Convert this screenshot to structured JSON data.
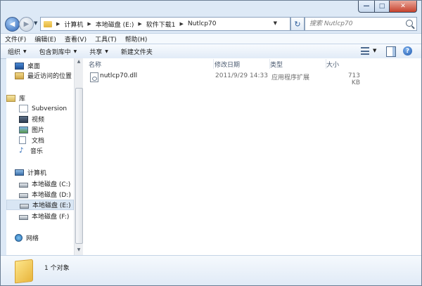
{
  "window": {
    "controls": {
      "minimize": "—",
      "maximize": "□",
      "close": "✕"
    }
  },
  "address": {
    "crumbs": [
      "计算机",
      "本地磁盘 (E:)",
      "软件下载1",
      "Nutlcp70"
    ],
    "search_placeholder": "搜索 Nutlcp70"
  },
  "menu": [
    "文件(F)",
    "编辑(E)",
    "查看(V)",
    "工具(T)",
    "帮助(H)"
  ],
  "commands": [
    {
      "label": "组织",
      "has_dropdown": true
    },
    {
      "label": "包含到库中",
      "has_dropdown": true
    },
    {
      "label": "共享",
      "has_dropdown": true
    },
    {
      "label": "新建文件夹",
      "has_dropdown": false
    }
  ],
  "help_label": "?",
  "nav": {
    "favorites": [
      {
        "label": "桌面",
        "icon": "desktop-icon"
      },
      {
        "label": "最近访问的位置",
        "icon": "recent-places-icon"
      }
    ],
    "libraries_label": "库",
    "libraries": [
      {
        "label": "Subversion",
        "icon": "subversion-icon"
      },
      {
        "label": "视频",
        "icon": "video-icon"
      },
      {
        "label": "图片",
        "icon": "picture-icon"
      },
      {
        "label": "文档",
        "icon": "document-icon"
      },
      {
        "label": "音乐",
        "icon": "music-icon"
      }
    ],
    "computer_label": "计算机",
    "drives": [
      {
        "label": "本地磁盘 (C:)",
        "icon": "system-drive-icon"
      },
      {
        "label": "本地磁盘 (D:)",
        "icon": "drive-icon"
      },
      {
        "label": "本地磁盘 (E:)",
        "icon": "drive-icon",
        "selected": true
      },
      {
        "label": "本地磁盘 (F:)",
        "icon": "drive-icon"
      }
    ],
    "network_label": "网络"
  },
  "columns": [
    "名称",
    "修改日期",
    "类型",
    "大小"
  ],
  "files": [
    {
      "name": "nutlcp70.dll",
      "modified": "2011/9/29 14:33",
      "type": "应用程序扩展",
      "size": "713 KB"
    }
  ],
  "details": {
    "count_text": "1 个对象"
  },
  "colors": {
    "frame": "#dde9f6",
    "selection": "#d9e6f4",
    "accent": "#2b64b6"
  }
}
